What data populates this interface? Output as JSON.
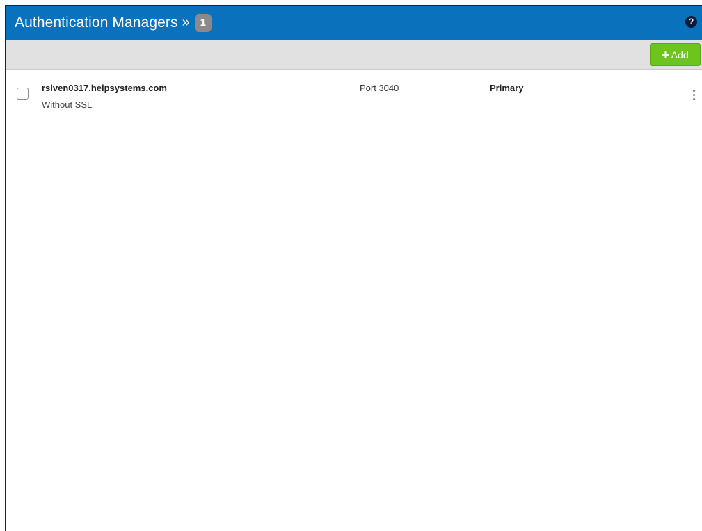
{
  "header": {
    "title": "Authentication Managers",
    "separator": "»",
    "count": "1",
    "help_icon": "question-circle-icon",
    "background_color": "#0a72bd"
  },
  "toolbar": {
    "add_label": "Add",
    "add_icon": "plus-icon",
    "add_color": "#6ec41e"
  },
  "rows": [
    {
      "host": "rsiven0317.helpsystems.com",
      "ssl": "Without SSL",
      "port": "Port 3040",
      "role": "Primary",
      "checked": false
    }
  ]
}
